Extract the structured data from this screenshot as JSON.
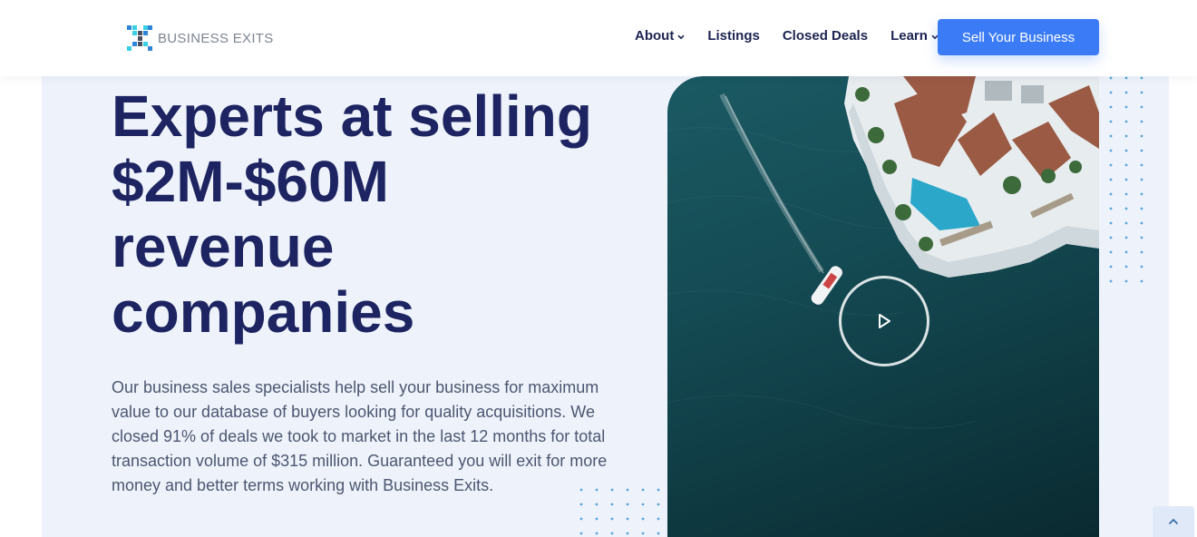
{
  "brand": {
    "logo_text": "BUSINESS EXITS",
    "logo_icon": "x-grid-logo-icon"
  },
  "nav": {
    "items": [
      {
        "label": "About",
        "has_dropdown": true
      },
      {
        "label": "Listings",
        "has_dropdown": false
      },
      {
        "label": "Closed Deals",
        "has_dropdown": false
      },
      {
        "label": "Learn",
        "has_dropdown": true
      }
    ],
    "cta_label": "Sell Your Business"
  },
  "hero": {
    "headline_lines": [
      "Experts at selling",
      "$2M-$60M",
      "revenue",
      "companies"
    ],
    "lead": "Our business sales specialists help sell your business for maximum value to our database of buyers looking for quality acquisitions. We closed 91% of deals we took to market in the last 12 months for total transaction volume of $315 million. Guaranteed you will exit for more money and better terms working with Business Exits.",
    "video_play_icon": "play-icon"
  },
  "colors": {
    "accent": "#3b7cf6",
    "headline": "#1d2461",
    "hero_bg": "#eef3fb",
    "body_text": "#4c5670"
  },
  "scroll_top_icon": "chevron-up-icon"
}
